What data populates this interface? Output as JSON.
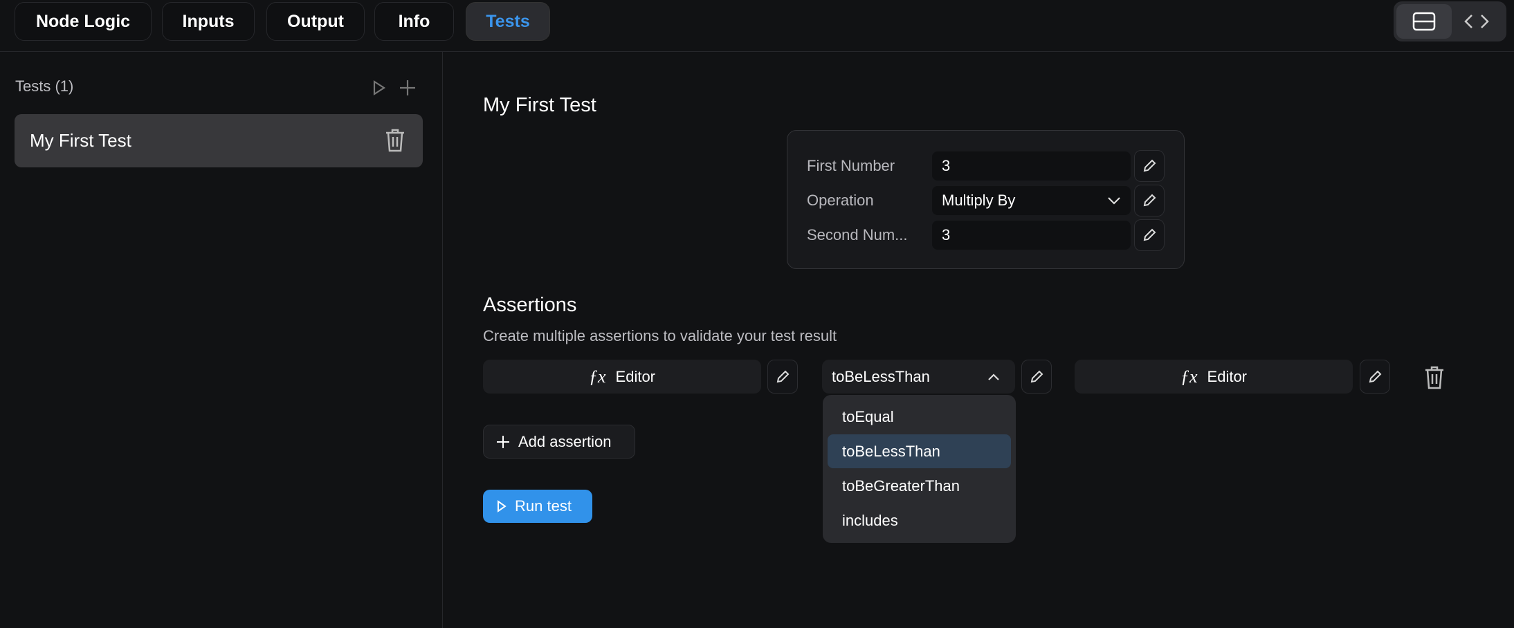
{
  "tabs": [
    {
      "label": "Node Logic"
    },
    {
      "label": "Inputs"
    },
    {
      "label": "Output"
    },
    {
      "label": "Info"
    },
    {
      "label": "Tests",
      "active": true
    }
  ],
  "view_toggle": {
    "icons": [
      "layout-split-icon",
      "code-icon"
    ],
    "active": 0
  },
  "sidebar": {
    "title": "Tests (1)",
    "items": [
      {
        "label": "My First Test"
      }
    ]
  },
  "main": {
    "title": "My First Test",
    "inputs": [
      {
        "label": "First Number",
        "value": "3"
      },
      {
        "label": "Operation",
        "value": "Multiply By"
      },
      {
        "label": "Second Num...",
        "value": "3"
      }
    ],
    "assertions_title": "Assertions",
    "assertions_subtitle": "Create multiple assertions to validate your test result",
    "assertion": {
      "left": "Editor",
      "operator": "toBeLessThan",
      "right": "Editor"
    },
    "operator_options": [
      "toEqual",
      "toBeLessThan",
      "toBeGreaterThan",
      "includes"
    ],
    "selected_option": "toBeLessThan",
    "add_assertion": "Add assertion",
    "run_test": "Run test"
  },
  "colors": {
    "accent": "#3192ea",
    "background": "#111214",
    "highlight": "#2f4155"
  }
}
